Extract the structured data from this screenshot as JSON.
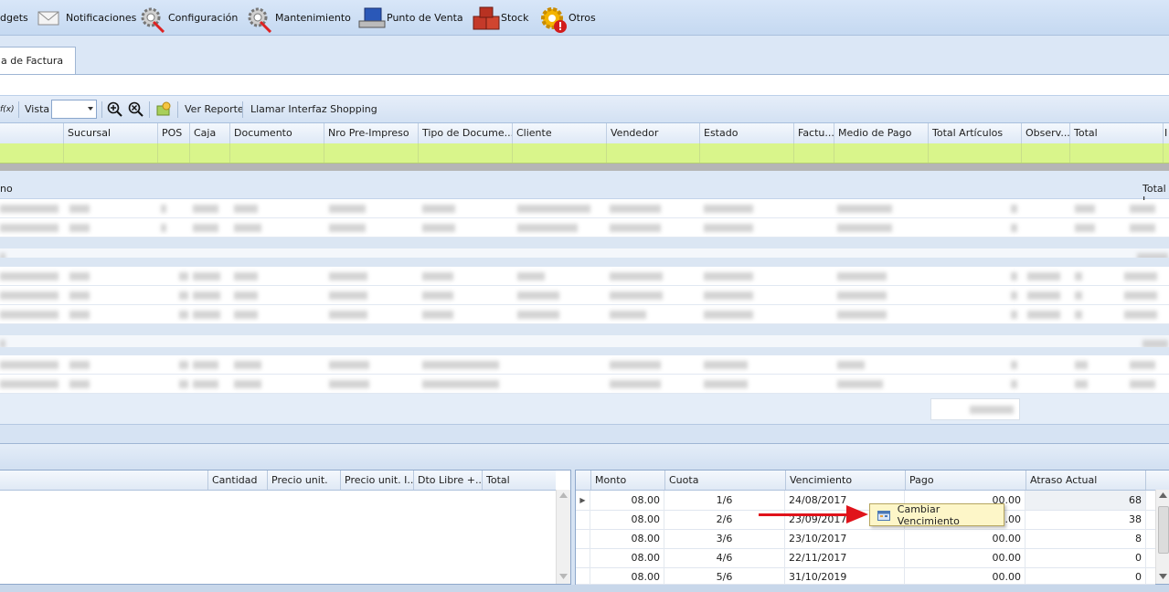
{
  "menubar": {
    "items": [
      {
        "label": "dgets",
        "icon": "widgets-icon"
      },
      {
        "label": "Notificaciones",
        "icon": "envelope-icon"
      },
      {
        "label": "Configuración",
        "icon": "gear-wrench-icon"
      },
      {
        "label": "Mantenimiento",
        "icon": "gear-wrench-icon"
      },
      {
        "label": "Punto de Venta",
        "icon": "computer-icon"
      },
      {
        "label": "Stock",
        "icon": "boxes-icon"
      },
      {
        "label": "Otros",
        "icon": "gear-alert-icon"
      }
    ]
  },
  "tabs": [
    {
      "label": "a de Factura"
    }
  ],
  "toolbar": {
    "fx_label": "f(x)",
    "vista_label": "Vista",
    "vista_value": "",
    "zoom_in_icon": "zoom-in-icon",
    "zoom_reset_icon": "zoom-reset-icon",
    "export_icon": "export-icon",
    "ver_reporte": "Ver Reporte",
    "llamar_interfaz": "Llamar Interfaz Shopping"
  },
  "main_grid": {
    "columns": [
      "Sucursal",
      "POS",
      "Caja",
      "Documento",
      "Nro Pre-Impreso",
      "Tipo de Docume...",
      "Cliente",
      "Vendedor",
      "Estado",
      "Factu...",
      "Medio de Pago",
      "Total Artículos",
      "Observ...",
      "Total",
      "I"
    ],
    "group_label": "no",
    "group_total_label": "Total I"
  },
  "detail_grid": {
    "columns": [
      "Cantidad",
      "Precio unit.",
      "Precio unit. I...",
      "Dto Libre +...",
      "Total"
    ]
  },
  "cuotas_grid": {
    "columns": [
      "Monto",
      "Cuota",
      "Vencimiento",
      "Pago",
      "Atraso Actual"
    ],
    "rows": [
      {
        "monto": "08.00",
        "cuota": "1/6",
        "vencimiento": "24/08/2017",
        "pago": "00.00",
        "atraso": "68"
      },
      {
        "monto": "08.00",
        "cuota": "2/6",
        "vencimiento": "23/09/2017",
        "pago": "00.00",
        "atraso": "38"
      },
      {
        "monto": "08.00",
        "cuota": "3/6",
        "vencimiento": "23/10/2017",
        "pago": "00.00",
        "atraso": "8"
      },
      {
        "monto": "08.00",
        "cuota": "4/6",
        "vencimiento": "22/11/2017",
        "pago": "00.00",
        "atraso": "0"
      },
      {
        "monto": "08.00",
        "cuota": "5/6",
        "vencimiento": "31/10/2019",
        "pago": "00.00",
        "atraso": "0"
      }
    ]
  },
  "context_menu": {
    "item_label": "Cambiar Vencimiento",
    "icon": "calendar-icon"
  },
  "colors": {
    "filter_row": "#d9f58b",
    "accent_blue": "#dde8f6",
    "arrow": "#e0131b"
  }
}
